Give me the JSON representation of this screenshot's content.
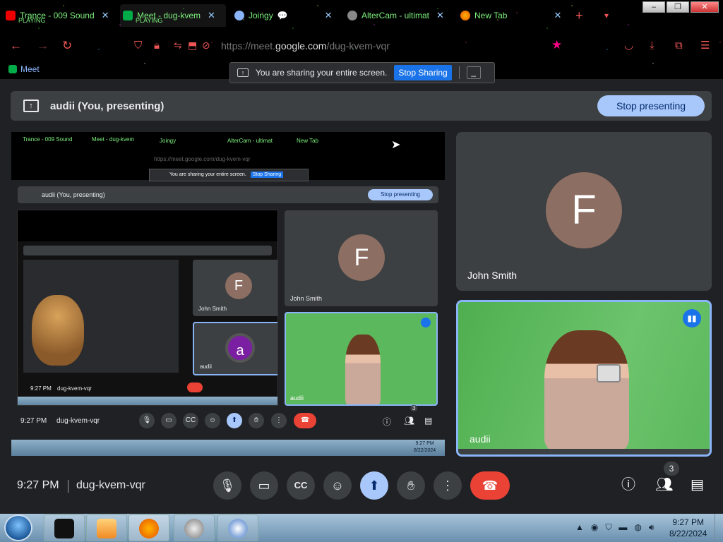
{
  "browser": {
    "tabs": [
      {
        "title": "Trance - 009 Sound",
        "subtitle": "PLAYING"
      },
      {
        "title": "Meet - dug-kvem",
        "subtitle": "PLAYING"
      },
      {
        "title": "Joingy"
      },
      {
        "title": "AlterCam - ultimat"
      },
      {
        "title": "New Tab"
      }
    ],
    "new_tab_icon": "+",
    "url_prefix": "https://meet.",
    "url_domain": "google.com",
    "url_path": "/dug-kvem-vqr",
    "meet_label": "Meet"
  },
  "share_banner": {
    "text": "You are sharing your entire screen.",
    "stop_label": "Stop Sharing",
    "min_label": "_"
  },
  "presenting": {
    "text": "audii (You, presenting)",
    "stop_label": "Stop presenting"
  },
  "mini": {
    "tab1": "Trance - 009 Sound",
    "tab2": "Meet - dug-kvem",
    "tab3": "Joingy",
    "tab4": "AlterCam - ultimat",
    "tab5": "New Tab",
    "url": "https://meet.google.com/dug-kvem-vqr",
    "present_text": "audii (You, presenting)",
    "stop_label": "Stop presenting",
    "banner": "You are sharing your entire screen.",
    "banner_stop": "Stop Sharing",
    "john": "John Smith",
    "audii": "audii",
    "avatar_a": "a",
    "avatar_f": "F",
    "clock": "9:27 PM",
    "code": "dug-kvem-vqr",
    "people_count": "3",
    "tray_time": "9:27 PM",
    "tray_date": "8/22/2024"
  },
  "tiles": {
    "john_name": "John Smith",
    "john_initial": "F",
    "audii_name": "audii"
  },
  "controls": {
    "clock": "9:27 PM",
    "meeting_code": "dug-kvem-vqr",
    "people_count": "3"
  },
  "taskbar": {
    "time": "9:27 PM",
    "date": "8/22/2024"
  }
}
